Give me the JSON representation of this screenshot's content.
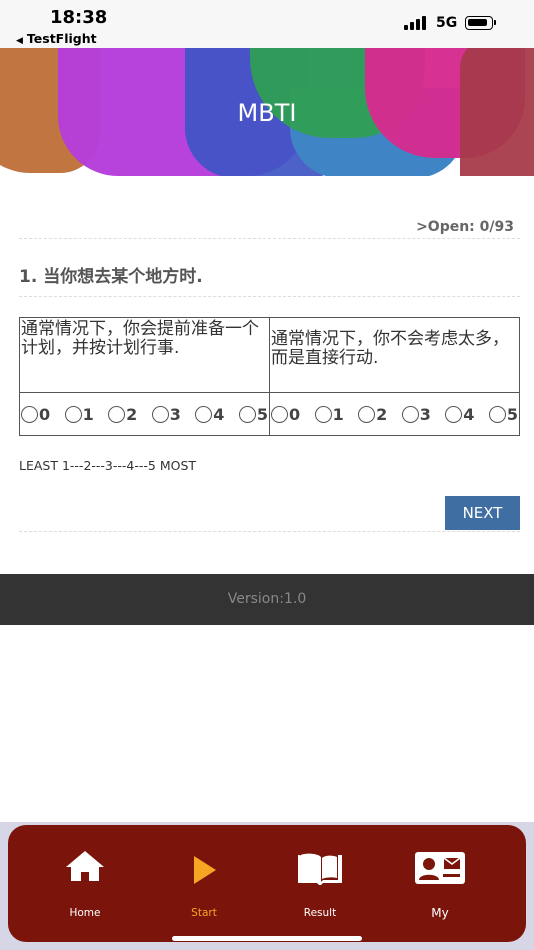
{
  "status_bar": {
    "time": "18:38",
    "back_label": "TestFlight",
    "network": "5G"
  },
  "header": {
    "title": "MBTI"
  },
  "quiz": {
    "open_count": ">Open: 0/93",
    "question": "1. 当你想去某个地方时.",
    "option_left": "通常情况下，你会提前准备一个计划，并按计划行事.",
    "option_right": "通常情况下，你不会考虑太多，而是直接行动.",
    "scale": [
      "0",
      "1",
      "2",
      "3",
      "4",
      "5"
    ],
    "scale_note": "LEAST 1---2---3---4---5 MOST",
    "next_label": "NEXT"
  },
  "footer": {
    "version": "Version:1.0"
  },
  "tabbar": {
    "items": [
      {
        "label": "Home",
        "icon": "home-icon",
        "color": "#ffffff"
      },
      {
        "label": "Start",
        "icon": "play-icon",
        "color": "#f5a623"
      },
      {
        "label": "Result",
        "icon": "book-icon",
        "color": "#ffffff"
      },
      {
        "label": "My",
        "icon": "contact-card-icon",
        "color": "#ffffff"
      }
    ]
  },
  "colors": {
    "banner_orange": "#c17541",
    "banner_magenta": "#b63ddb",
    "banner_blue": "#3e55c4",
    "banner_green": "#2f9e55",
    "banner_pink": "#d62b8f",
    "banner_red": "#a63a4a",
    "next_button": "#3f6ea3",
    "tabbar": "#7b150b",
    "tab_active": "#f5a623"
  }
}
